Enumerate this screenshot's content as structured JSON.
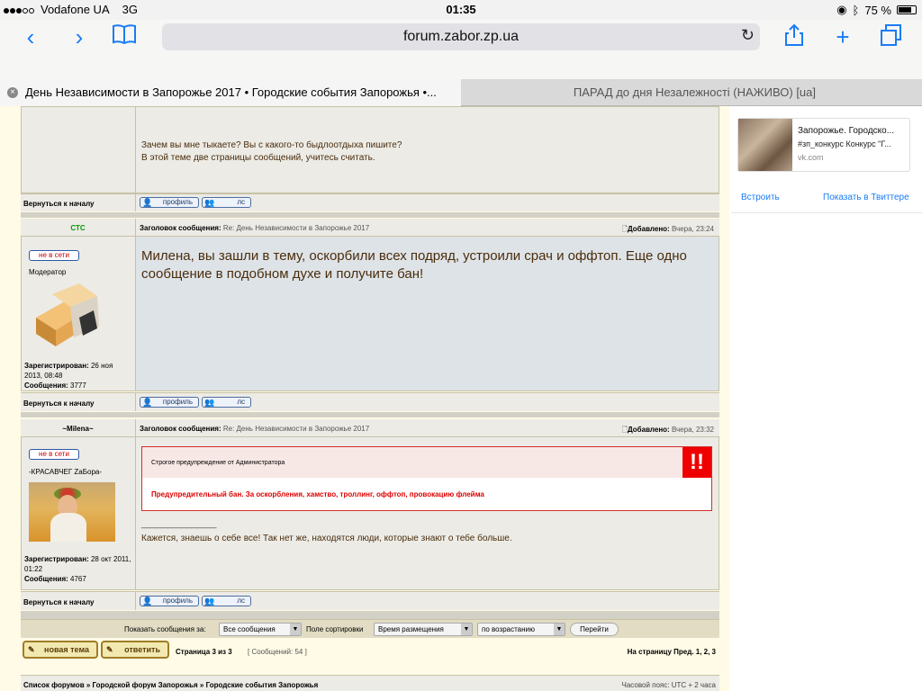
{
  "status": {
    "carrier": "Vodafone UA",
    "network": "3G",
    "time": "01:35",
    "battery": "75 %"
  },
  "browser": {
    "url": "forum.zabor.zp.ua"
  },
  "tabs": [
    {
      "label": "День Независимости в Запорожье 2017 • Городские события Запорожья •..."
    },
    {
      "label": "ПАРАД до дня Незалежності (НАЖИВО) [ua]"
    }
  ],
  "post_prev": {
    "text1": "Зачем вы мне тыкаете? Вы с какого-то быдлоотдыха пишите?",
    "text2": "В этой теме две страницы сообщений, учитесь считать.",
    "back": "Вернуться к началу",
    "btn_profile": "профиль",
    "btn_pm": "лс"
  },
  "post1": {
    "author": "СТС",
    "subject_label": "Заголовок сообщения:",
    "subject": "Re: День Независимости в Запорожье 2017",
    "posted_label": "Добавлено:",
    "posted": "Вчера, 23:24",
    "status": "не в сети",
    "rank": "Модератор",
    "reg_label": "Зарегистрирован:",
    "reg_date": "26 ноя 2013, 08:48",
    "posts_label": "Сообщения:",
    "posts": "3777",
    "message": "Милена, вы зашли в тему, оскорбили всех подряд, устроили срач и оффтоп. Еще одно сообщение в подобном духе и получите бан!",
    "back": "Вернуться к началу",
    "btn_profile": "профиль",
    "btn_pm": "лс"
  },
  "post2": {
    "author": "~Milena~",
    "subject_label": "Заголовок сообщения:",
    "subject": "Re: День Независимости в Запорожье 2017",
    "posted_label": "Добавлено:",
    "posted": "Вчера, 23:32",
    "status": "не в сети",
    "rank": "-КРАСАВЧЕГ ZаБора-",
    "reg_label": "Зарегистрирован:",
    "reg_date": "28 окт 2011, 01:22",
    "posts_label": "Сообщения:",
    "posts": "4767",
    "warning_title": "Строгое предупреждение от Администратора",
    "warning_icon": "!!",
    "warning_text": "Предупредительный бан. За оскорбления, хамство, троллинг, оффтоп, провокацию флейма",
    "separator": "_______________",
    "message": "Кажется, знаешь о себе все! Так нет же, находятся люди, которые знают о тебе больше.",
    "back": "Вернуться к началу",
    "btn_profile": "профиль",
    "btn_pm": "лс"
  },
  "sort": {
    "show_label": "Показать сообщения за:",
    "show_value": "Все сообщения",
    "sort_label": "Поле сортировки",
    "sort_value": "Время размещения",
    "order_value": "по возрастанию",
    "go": "Перейти"
  },
  "pager": {
    "new_topic": "новая тема",
    "reply": "ответить",
    "page_info": "Страница 3 из 3",
    "count": "[ Сообщений: 54 ]",
    "goto": "На страницу Пред.  1, 2, 3"
  },
  "footer": {
    "breadcrumb": "Список форумов » Городской форум Запорожья » Городские события Запорожья",
    "timezone": "Часовой пояс: UTC + 2 часа"
  },
  "embed": {
    "title": "Запорожье. Городско...",
    "desc": "#зп_конкурс Конкурс \"Г...",
    "domain": "vk.com",
    "embed_link": "Встроить",
    "twitter_link": "Показать в Твиттере"
  }
}
